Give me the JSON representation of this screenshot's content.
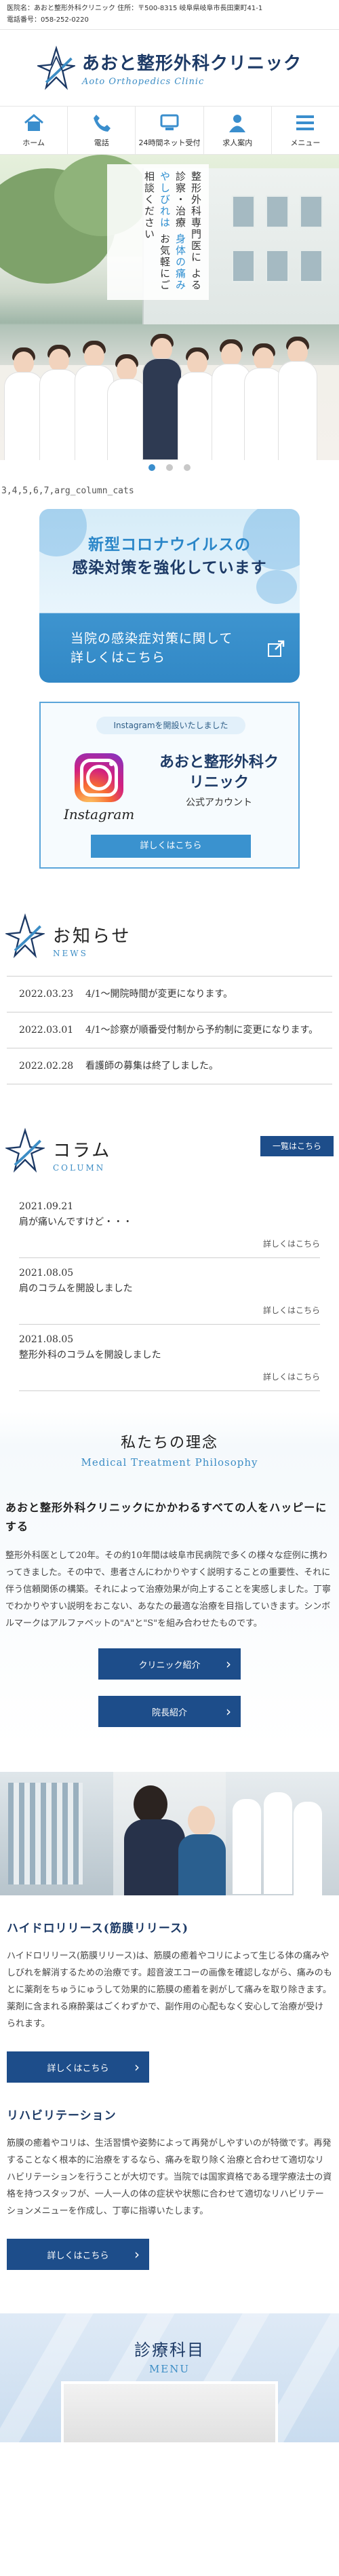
{
  "topbar": {
    "line1": "医院名：あおと整形外科クリニック 住所：〒500-8315 岐阜県岐阜市長田東町41-1",
    "line2": "電話番号：058-252-0220"
  },
  "logo": {
    "name": "あおと整形外科クリニック",
    "roman": "Aoto Orthopedics Clinic"
  },
  "nav": [
    {
      "label": "ホーム",
      "icon": "home-icon"
    },
    {
      "label": "電話",
      "icon": "phone-icon"
    },
    {
      "label": "24時間ネット受付",
      "icon": "net-reception-icon"
    },
    {
      "label": "求人案内",
      "icon": "person-icon"
    },
    {
      "label": "メニュー",
      "icon": "menu-icon"
    }
  ],
  "hero": {
    "copy_pre": "整形外科専門医に",
    "copy_mid1": "よる診察・治療",
    "copy_mid2": "身体の痛みやしびれは",
    "copy_post": "お気軽にご相談ください"
  },
  "stray_text": "3,4,5,6,7,arg_column_cats",
  "corona": {
    "line1": "新型コロナウイルスの",
    "line2": "感染対策を強化しています",
    "cta1": "当院の感染症対策に関して",
    "cta2": "詳しくはこちら"
  },
  "instagram": {
    "pill": "Instagramを開設いたしました",
    "word": "Instagram",
    "name": "あおと整形外科クリニック",
    "sub": "公式アカウント",
    "button": "詳しくはこちら"
  },
  "news": {
    "title": "お知らせ",
    "en": "NEWS",
    "items": [
      {
        "date": "2022.03.23",
        "text": "4/1～開院時間が変更になります。"
      },
      {
        "date": "2022.03.01",
        "text": "4/1～診察が順番受付制から予約制に変更になります。"
      },
      {
        "date": "2022.02.28",
        "text": "看護師の募集は終了しました。"
      }
    ]
  },
  "column": {
    "title": "コラム",
    "en": "COLUMN",
    "more": "一覧はこちら",
    "read_more": "詳しくはこちら",
    "items": [
      {
        "date": "2021.09.21",
        "title": "肩が痛いんですけど・・・"
      },
      {
        "date": "2021.08.05",
        "title": "肩のコラムを開設しました"
      },
      {
        "date": "2021.08.05",
        "title": "整形外科のコラムを開設しました"
      }
    ]
  },
  "philosophy": {
    "title": "私たちの理念",
    "en": "Medical Treatment Philosophy",
    "lead": "あおと整形外科クリニックにかかわるすべての人をハッピーにする",
    "body": "整形外科医として20年。その約10年間は岐阜市民病院で多くの様々な症例に携わってきました。その中で、患者さんにわかりやすく説明することの重要性、それに伴う信頼関係の構築。それによって治療効果が向上することを実感しました。丁寧でわかりやすい説明をおこない、あなたの最適な治療を目指していきます。シンボルマークはアルファベットの\"A\"と\"S\"を組み合わせたものです。",
    "btn1": "クリニック紹介",
    "btn2": "院長紹介"
  },
  "hydro": {
    "title": "ハイドロリリース(筋膜リリース)",
    "body": "ハイドロリリース(筋膜リリース)は、筋膜の癒着やコリによって生じる体の痛みやしびれを解消するための治療です。超音波エコーの画像を確認しながら、痛みのもとに薬剤をちゅうにゅうして効果的に筋膜の癒着を剥がして痛みを取り除きます。薬剤に含まれる麻酔薬はごくわずかで、副作用の心配もなく安心して治療が受けられます。",
    "button": "詳しくはこちら"
  },
  "rehab": {
    "title": "リハビリテーション",
    "body": "筋膜の癒着やコリは、生活習慣や姿勢によって再発がしやすいのが特徴です。再発することなく根本的に治療をするなら、痛みを取り除く治療と合わせて適切なリハビリテーションを行うことが大切です。当院では国家資格である理学療法士の資格を持つスタッフが、一人一人の体の症状や状態に合わせて適切なリハビリテーションメニューを作成し、丁寧に指導いたします。",
    "button": "詳しくはこちら"
  },
  "menu_section": {
    "title": "診療科目",
    "en": "MENU"
  },
  "colors": {
    "navy": "#1d4d8a",
    "accent": "#3a8ecd",
    "dark_text": "#1d3a66"
  }
}
